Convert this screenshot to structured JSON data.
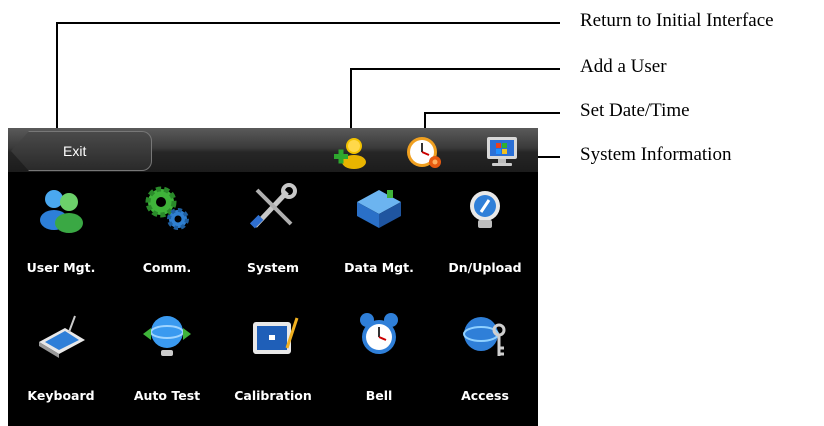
{
  "callouts": {
    "return": "Return to Initial Interface",
    "add_user": "Add a User",
    "set_date": "Set Date/Time",
    "system_info": "System Information"
  },
  "topbar": {
    "exit_label": "Exit",
    "icons": [
      "add-user-icon",
      "clock-icon",
      "monitor-icon"
    ]
  },
  "menu": [
    {
      "label": "User Mgt.",
      "icon": "users-icon"
    },
    {
      "label": "Comm.",
      "icon": "gears-icon"
    },
    {
      "label": "System",
      "icon": "tools-icon"
    },
    {
      "label": "Data Mgt.",
      "icon": "folder-icon"
    },
    {
      "label": "Dn/Upload",
      "icon": "usb-drive-icon"
    },
    {
      "label": "Keyboard",
      "icon": "keyboard-icon"
    },
    {
      "label": "Auto Test",
      "icon": "globe-test-icon"
    },
    {
      "label": "Calibration",
      "icon": "calibration-icon"
    },
    {
      "label": "Bell",
      "icon": "alarm-bell-icon"
    },
    {
      "label": "Access",
      "icon": "access-keys-icon"
    }
  ]
}
